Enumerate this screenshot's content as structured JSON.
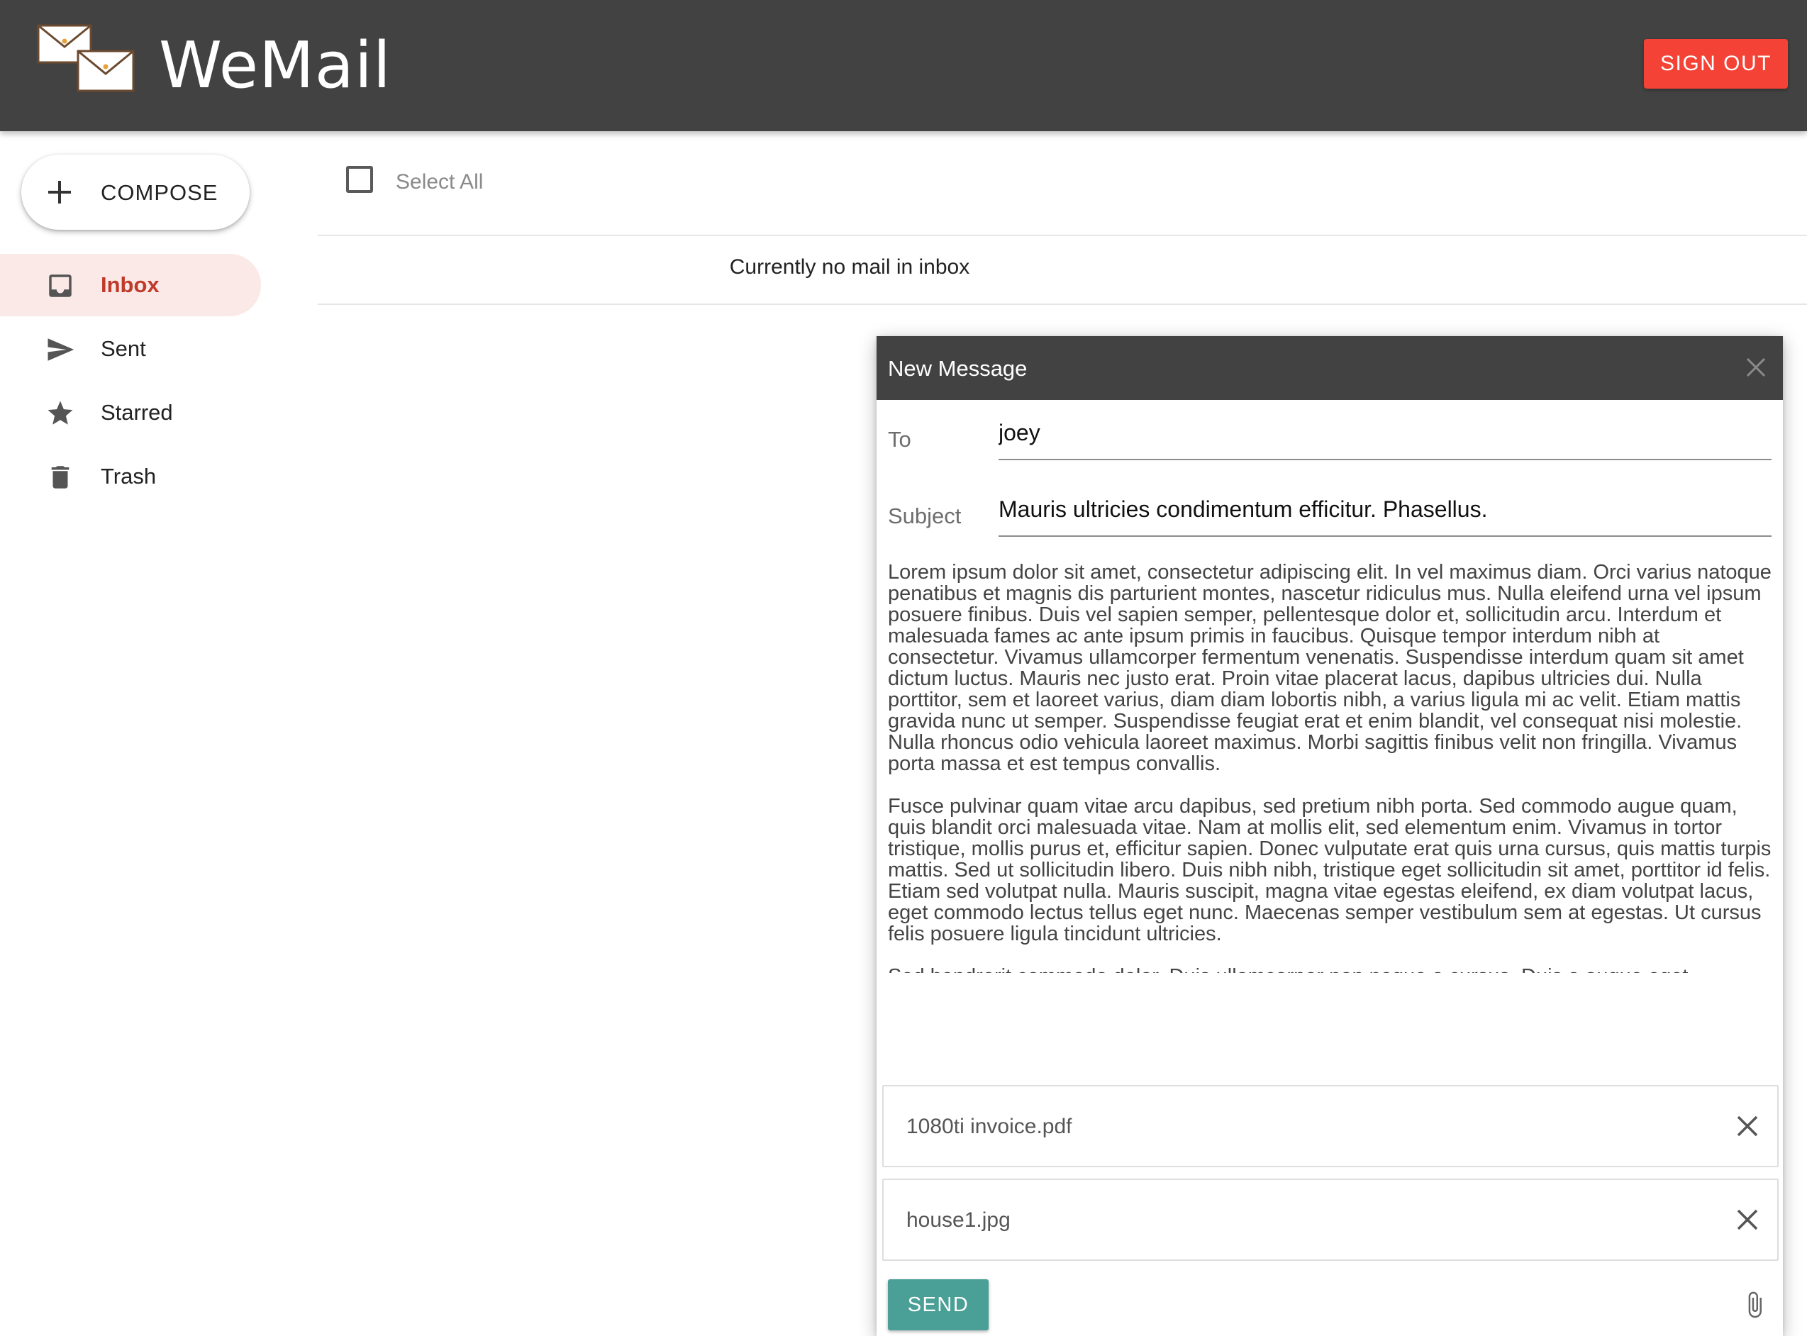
{
  "app": {
    "brand": "WeMail",
    "signout_label": "SIGN OUT",
    "colors": {
      "appbar": "#424242",
      "signout": "#f44336",
      "active_nav_bg": "#fbe9e7",
      "active_nav_text": "#bf3a2b",
      "send": "#4a9f96"
    }
  },
  "sidebar": {
    "compose_label": "COMPOSE",
    "items": [
      {
        "label": "Inbox",
        "icon": "inbox-icon",
        "active": true
      },
      {
        "label": "Sent",
        "icon": "send-icon",
        "active": false
      },
      {
        "label": "Starred",
        "icon": "star-icon",
        "active": false
      },
      {
        "label": "Trash",
        "icon": "trash-icon",
        "active": false
      }
    ]
  },
  "list": {
    "select_all_label": "Select All",
    "empty_message": "Currently no mail in inbox"
  },
  "compose_dialog": {
    "title": "New Message",
    "to_label": "To",
    "to_value": "joey",
    "subject_label": "Subject",
    "subject_value": "Mauris ultricies condimentum efficitur. Phasellus.",
    "body": "Lorem ipsum dolor sit amet, consectetur adipiscing elit. In vel maximus diam. Orci varius natoque penatibus et magnis dis parturient montes, nascetur ridiculus mus. Nulla eleifend urna vel ipsum posuere finibus. Duis vel sapien semper, pellentesque dolor et, sollicitudin arcu. Interdum et malesuada fames ac ante ipsum primis in faucibus. Quisque tempor interdum nibh at consectetur. Vivamus ullamcorper fermentum venenatis. Suspendisse interdum quam sit amet dictum luctus. Mauris nec justo erat. Proin vitae placerat lacus, dapibus ultricies dui. Nulla porttitor, sem et laoreet varius, diam diam lobortis nibh, a varius ligula mi ac velit. Etiam mattis gravida nunc ut semper. Suspendisse feugiat erat et enim blandit, vel consequat nisi molestie. Nulla rhoncus odio vehicula laoreet maximus. Morbi sagittis finibus velit non fringilla. Vivamus porta massa et est tempus convallis.\n\nFusce pulvinar quam vitae arcu dapibus, sed pretium nibh porta. Sed commodo augue quam, quis blandit orci malesuada vitae. Nam at mollis elit, sed elementum enim. Vivamus in tortor tristique, mollis purus et, efficitur sapien. Donec vulputate erat quis urna cursus, quis mattis turpis mattis. Sed ut sollicitudin libero. Duis nibh nibh, tristique eget sollicitudin sit amet, porttitor id felis. Etiam sed volutpat nulla. Mauris suscipit, magna vitae egestas eleifend, ex diam volutpat lacus, eget commodo lectus tellus eget nunc. Maecenas semper vestibulum sem at egestas. Ut cursus felis posuere ligula tincidunt ultricies.\n\nSed hendrerit commodo dolor. Duis ullamcorper non neque a cursus. Duis a augue eget",
    "attachments": [
      {
        "name": "1080ti invoice.pdf"
      },
      {
        "name": "house1.jpg"
      }
    ],
    "send_label": "SEND"
  }
}
